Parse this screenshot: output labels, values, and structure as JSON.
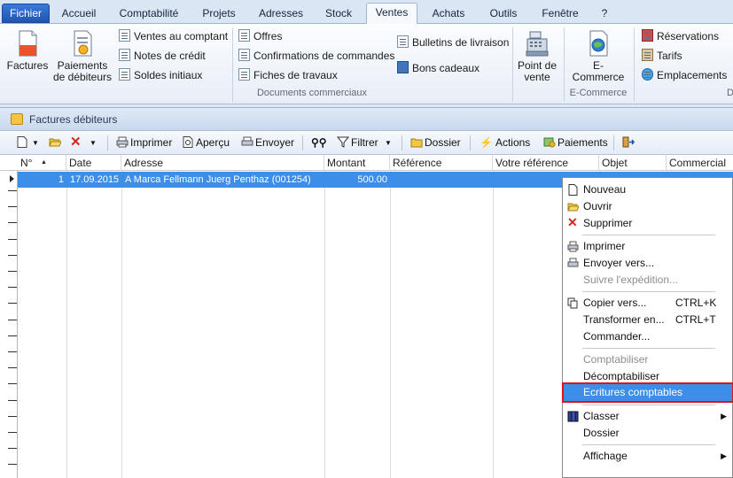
{
  "tabs": {
    "file": "Fichier",
    "items": [
      "Accueil",
      "Comptabilité",
      "Projets",
      "Adresses",
      "Stock",
      "Ventes",
      "Achats",
      "Outils",
      "Fenêtre",
      "?"
    ],
    "active": "Ventes"
  },
  "ribbon": {
    "large": {
      "factures": "Factures",
      "paiements": "Paiements de débiteurs",
      "point_de_vente": "Point de vente",
      "ecommerce": "E-Commerce"
    },
    "small_col1": [
      "Ventes au comptant",
      "Notes de crédit",
      "Soldes initiaux"
    ],
    "small_col2": [
      "Offres",
      "Confirmations de commandes",
      "Fiches de travaux"
    ],
    "small_col3": [
      "Bulletins de livraison",
      "Bons cadeaux"
    ],
    "small_col4": [
      "Réservations",
      "Tarifs",
      "Emplacements"
    ],
    "groups": {
      "documents": "Documents commerciaux",
      "ecommerce": "E-Commerce",
      "cut": "D"
    }
  },
  "document": {
    "title": "Factures débiteurs",
    "toolbar": {
      "imprimer": "Imprimer",
      "apercu": "Aperçu",
      "envoyer": "Envoyer",
      "filtrer": "Filtrer",
      "dossier": "Dossier",
      "actions": "Actions",
      "paiements": "Paiements"
    },
    "columns": [
      "N°",
      "Date",
      "Adresse",
      "Montant",
      "Référence",
      "Votre référence",
      "Objet",
      "Commercial"
    ],
    "rows": [
      {
        "no": "1",
        "date": "17.09.2015",
        "adresse": "A Marca Fellmann Juerg Penthaz (001254)",
        "montant": "500.00"
      }
    ]
  },
  "context_menu": {
    "nouveau": "Nouveau",
    "ouvrir": "Ouvrir",
    "supprimer": "Supprimer",
    "imprimer": "Imprimer",
    "envoyer_vers": "Envoyer vers...",
    "suivre": "Suivre l'expédition...",
    "copier_vers": "Copier vers...",
    "copier_sc": "CTRL+K",
    "transformer": "Transformer en...",
    "transformer_sc": "CTRL+T",
    "commander": "Commander...",
    "comptabiliser": "Comptabiliser",
    "decomptabiliser": "Décomptabiliser",
    "ecritures": "Ecritures comptables",
    "classer": "Classer",
    "dossier": "Dossier",
    "affichage": "Affichage"
  },
  "colors": {
    "selection": "#3d8ee8",
    "highlight_border": "#e0121a",
    "file_tab": "#1f55b0"
  }
}
